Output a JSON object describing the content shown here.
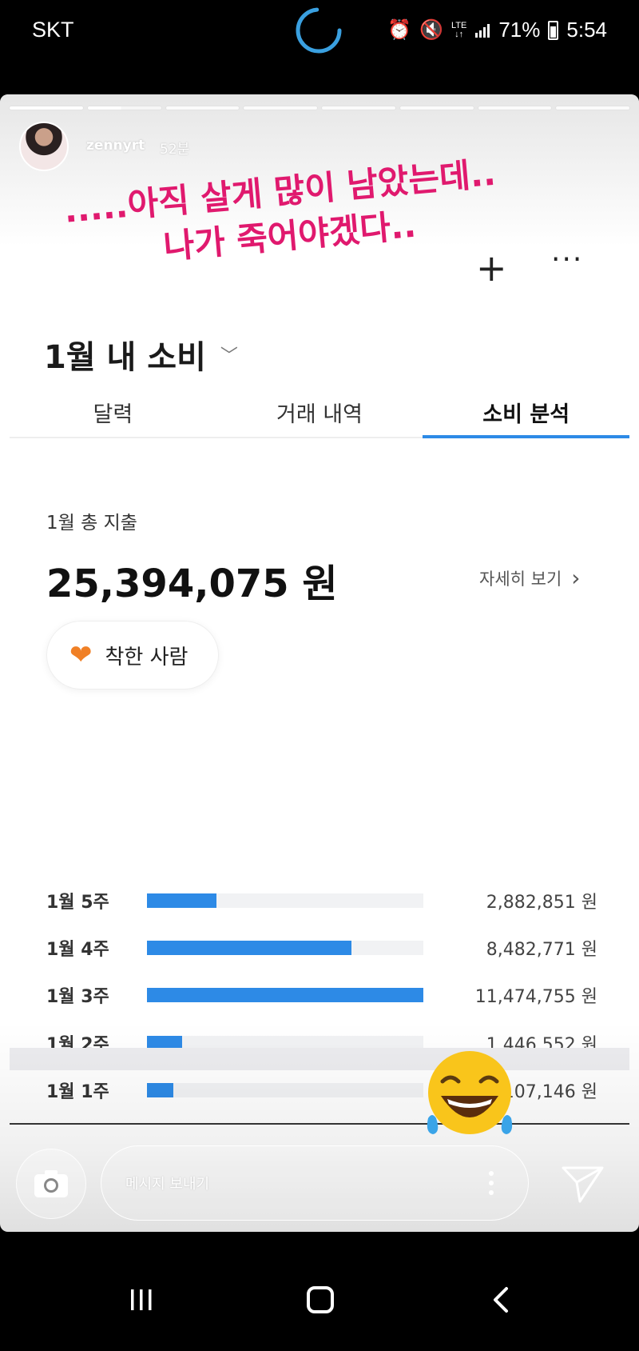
{
  "status_bar": {
    "carrier": "SKT",
    "battery": "71%",
    "clock": "5:54",
    "network": "LTE"
  },
  "story": {
    "username": "zennyrt",
    "time_ago": "52분",
    "caption_line1": ".....아직 살게 많이 남았는데..",
    "caption_line2": "나가 죽어야겠다.."
  },
  "app": {
    "plus_label": "+",
    "more_label": "···",
    "month_title": "1월 내 소비",
    "tabs": [
      {
        "label": "달력",
        "active": false
      },
      {
        "label": "거래 내역",
        "active": false
      },
      {
        "label": "소비 분석",
        "active": true
      }
    ],
    "total_label": "1월 총 지출",
    "total_amount": "25,394,075 원",
    "detail_link": "자세히 보기",
    "badge_label": "착한 사람",
    "accent_color": "#2d8ae6"
  },
  "chart_data": {
    "type": "bar",
    "orientation": "horizontal",
    "categories": [
      "1월 5주",
      "1월 4주",
      "1월 3주",
      "1월 2주",
      "1월 1주"
    ],
    "values": [
      2882851,
      8482771,
      11474755,
      1446552,
      1107146
    ],
    "value_labels": [
      "2,882,851 원",
      "8,482,771 원",
      "11,474,755 원",
      "1,446,552 원",
      "1,107,146 원"
    ],
    "xlim": [
      0,
      11474755
    ],
    "grid": false
  },
  "reply_bar": {
    "placeholder": "메시지 보내기"
  },
  "icons": [
    "camera-icon",
    "send-icon",
    "more-vertical-icon",
    "alarm-icon",
    "mute-icon",
    "signal-icon",
    "battery-icon",
    "heart-icon",
    "chevron-down-icon",
    "chevron-right-icon",
    "laughing-emoji-icon"
  ],
  "nav_bar": {
    "buttons": [
      "recents",
      "home",
      "back"
    ]
  }
}
